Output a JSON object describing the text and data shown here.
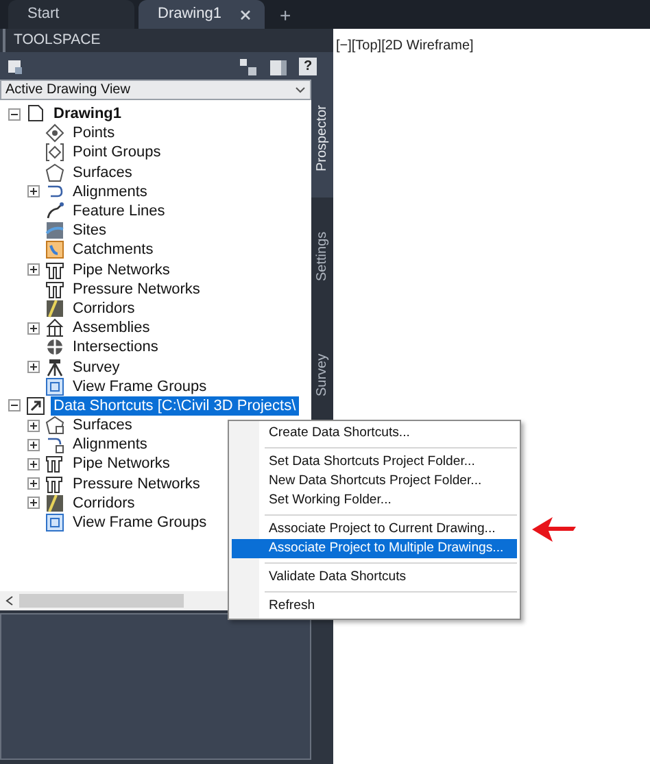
{
  "doc_tabs": [
    {
      "label": "Start",
      "selected": false,
      "closable": false
    },
    {
      "label": "Drawing1",
      "selected": true,
      "closable": true
    }
  ],
  "new_tab_button": "+",
  "toolspace": {
    "title": "TOOLSPACE",
    "help_button": "?",
    "view_dropdown": {
      "value": "Active Drawing View"
    },
    "side_tabs": [
      {
        "label": "Prospector",
        "selected": true
      },
      {
        "label": "Settings",
        "selected": false
      },
      {
        "label": "Survey",
        "selected": false
      }
    ],
    "tree": [
      {
        "label": "Drawing1",
        "bold": true,
        "selected": false,
        "kind": "folder",
        "expanded": true,
        "children": [
          {
            "label": "Points",
            "kind": "leaf"
          },
          {
            "label": "Point Groups",
            "kind": "leaf"
          },
          {
            "label": "Surfaces",
            "kind": "leaf"
          },
          {
            "label": "Alignments",
            "kind": "folder",
            "expanded": false
          },
          {
            "label": "Feature Lines",
            "kind": "leaf"
          },
          {
            "label": "Sites",
            "kind": "leaf"
          },
          {
            "label": "Catchments",
            "kind": "leaf"
          },
          {
            "label": "Pipe Networks",
            "kind": "folder",
            "expanded": false
          },
          {
            "label": "Pressure Networks",
            "kind": "leaf"
          },
          {
            "label": "Corridors",
            "kind": "leaf"
          },
          {
            "label": "Assemblies",
            "kind": "folder",
            "expanded": false
          },
          {
            "label": "Intersections",
            "kind": "leaf"
          },
          {
            "label": "Survey",
            "kind": "folder",
            "expanded": false
          },
          {
            "label": "View Frame Groups",
            "kind": "leaf"
          }
        ]
      },
      {
        "label": "Data Shortcuts [C:\\Civil 3D Projects\\",
        "bold": false,
        "selected": true,
        "kind": "folder",
        "expanded": true,
        "children": [
          {
            "label": "Surfaces",
            "kind": "folder",
            "expanded": false
          },
          {
            "label": "Alignments",
            "kind": "folder",
            "expanded": false
          },
          {
            "label": "Pipe Networks",
            "kind": "folder",
            "expanded": false
          },
          {
            "label": "Pressure Networks",
            "kind": "folder",
            "expanded": false
          },
          {
            "label": "Corridors",
            "kind": "folder",
            "expanded": false
          },
          {
            "label": "View Frame Groups",
            "kind": "leaf"
          }
        ]
      }
    ]
  },
  "viewport": {
    "label": "[−][Top][2D Wireframe]"
  },
  "context_menu": {
    "groups": [
      [
        {
          "label": "Create Data Shortcuts...",
          "selected": false
        }
      ],
      [
        {
          "label": "Set Data Shortcuts Project Folder...",
          "selected": false
        },
        {
          "label": "New Data Shortcuts Project Folder...",
          "selected": false
        },
        {
          "label": "Set Working Folder...",
          "selected": false
        }
      ],
      [
        {
          "label": "Associate Project to Current Drawing...",
          "selected": false
        },
        {
          "label": "Associate Project to Multiple Drawings...",
          "selected": true
        }
      ],
      [
        {
          "label": "Validate Data Shortcuts",
          "selected": false
        }
      ],
      [
        {
          "label": "Refresh",
          "selected": false
        }
      ]
    ]
  }
}
